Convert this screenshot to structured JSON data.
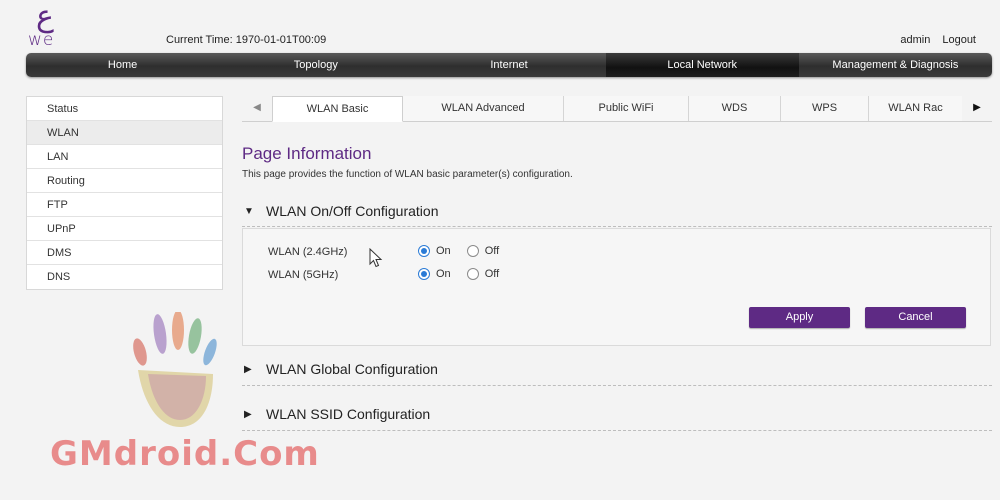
{
  "header": {
    "logo_text": "we",
    "current_time_label": "Current Time:",
    "current_time_value": "1970-01-01T00:09",
    "user": "admin",
    "logout": "Logout"
  },
  "nav": {
    "items": [
      "Home",
      "Topology",
      "Internet",
      "Local Network",
      "Management & Diagnosis"
    ],
    "active": "Local Network"
  },
  "sidebar": {
    "items": [
      "Status",
      "WLAN",
      "LAN",
      "Routing",
      "FTP",
      "UPnP",
      "DMS",
      "DNS"
    ],
    "active": "WLAN"
  },
  "tabs": {
    "items": [
      "WLAN Basic",
      "WLAN Advanced",
      "Public WiFi",
      "WDS",
      "WPS",
      "WLAN Rac"
    ],
    "active": "WLAN Basic"
  },
  "page": {
    "title": "Page Information",
    "description": "This page provides the function of WLAN basic parameter(s) configuration."
  },
  "sections": {
    "onoff": "WLAN On/Off Configuration",
    "global": "WLAN Global Configuration",
    "ssid": "WLAN SSID Configuration"
  },
  "wlan": {
    "band24_label": "WLAN (2.4GHz)",
    "band5_label": "WLAN (5GHz)",
    "on_label": "On",
    "off_label": "Off",
    "band24_state": "On",
    "band5_state": "On"
  },
  "buttons": {
    "apply": "Apply",
    "cancel": "Cancel"
  },
  "watermark": {
    "text": "GMdroid.Com"
  },
  "colors": {
    "brand_purple": "#5e2a84",
    "radio_blue": "#2b7bd6"
  }
}
